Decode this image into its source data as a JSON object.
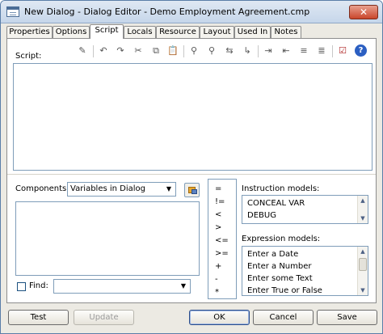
{
  "window": {
    "title": "New Dialog - Dialog Editor - Demo Employment Agreement.cmp",
    "close_glyph": "✕"
  },
  "tabs": [
    {
      "label": "Properties"
    },
    {
      "label": "Options"
    },
    {
      "label": "Script",
      "active": true
    },
    {
      "label": "Locals"
    },
    {
      "label": "Resource"
    },
    {
      "label": "Layout"
    },
    {
      "label": "Used In"
    },
    {
      "label": "Notes"
    }
  ],
  "script": {
    "label": "Script:",
    "value": ""
  },
  "toolbar": {
    "icons": [
      "magic-wand-icon",
      "undo-icon",
      "redo-icon",
      "cut-icon",
      "copy-icon",
      "paste-icon",
      "find-icon",
      "find-next-icon",
      "replace-icon",
      "go-to-icon",
      "indent-icon",
      "outdent-icon",
      "comment-icon",
      "uncomment-icon",
      "check-syntax-icon",
      "help-icon"
    ],
    "glyphs": [
      "✎",
      "↶",
      "↷",
      "✂",
      "⧉",
      "📋",
      "⚲",
      "⚲",
      "⇆",
      "↳",
      "⇥",
      "⇤",
      "≡",
      "≣",
      "☑",
      "?"
    ]
  },
  "components": {
    "label": "Components:",
    "selected": "Variables in Dialog",
    "items": []
  },
  "operators": [
    "=",
    "!=",
    "<",
    ">",
    "<=",
    ">=",
    "+",
    "-",
    "*"
  ],
  "instruction_models": {
    "label": "Instruction models:",
    "items": [
      "CONCEAL VAR",
      "DEBUG"
    ]
  },
  "expression_models": {
    "label": "Expression models:",
    "items": [
      "Enter a Date",
      "Enter a Number",
      "Enter some Text",
      "Enter True or False"
    ]
  },
  "find": {
    "label": "Find:",
    "checked": false,
    "value": ""
  },
  "buttons": {
    "test": "Test",
    "update": "Update",
    "ok": "OK",
    "cancel": "Cancel",
    "save": "Save"
  },
  "colors": {
    "titlebar": "#c6d6ea",
    "close_button": "#c9462b",
    "panel_border": "#8d8d8d",
    "field_border": "#7f9db9"
  }
}
